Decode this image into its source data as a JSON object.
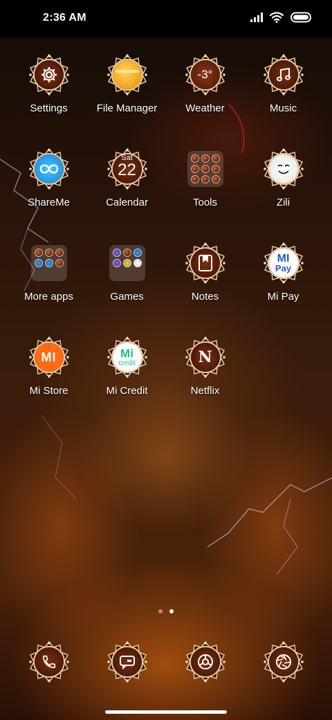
{
  "status_bar": {
    "time": "2:36 AM",
    "signal_icon": "cellular-signal-icon",
    "wifi_icon": "wifi-icon",
    "battery_icon": "battery-icon"
  },
  "home_screen": {
    "apps": [
      {
        "label": "Settings",
        "icon": "gear-icon"
      },
      {
        "label": "File Manager",
        "icon": "folder-icon"
      },
      {
        "label": "Weather",
        "icon": "weather-icon",
        "temperature": "-3°"
      },
      {
        "label": "Music",
        "icon": "music-note-icon"
      },
      {
        "label": "ShareMe",
        "icon": "shareme-icon"
      },
      {
        "label": "Calendar",
        "icon": "calendar-icon",
        "day": "Sat",
        "date": "22"
      },
      {
        "label": "Tools",
        "icon": "folder-icon"
      },
      {
        "label": "Zili",
        "icon": "zili-icon"
      },
      {
        "label": "More apps",
        "icon": "folder-icon"
      },
      {
        "label": "Games",
        "icon": "folder-icon"
      },
      {
        "label": "Notes",
        "icon": "notes-icon"
      },
      {
        "label": "Mi Pay",
        "icon": "mi-pay-icon",
        "logo_line1": "MI",
        "logo_line2": "Pay"
      },
      {
        "label": "Mi Store",
        "icon": "mi-store-icon",
        "logo_text": "MI"
      },
      {
        "label": "Mi Credit",
        "icon": "mi-credit-icon",
        "logo_line1": "Mi",
        "logo_line2": "credit"
      },
      {
        "label": "Netflix",
        "icon": "netflix-icon",
        "logo_text": "N"
      }
    ],
    "page_indicator": {
      "pages": 2,
      "active_page": 2
    }
  },
  "dock": {
    "apps": [
      {
        "name": "Phone",
        "icon": "phone-icon"
      },
      {
        "name": "Messages",
        "icon": "message-icon"
      },
      {
        "name": "Browser",
        "icon": "browser-icon"
      },
      {
        "name": "Camera",
        "icon": "camera-icon"
      }
    ]
  },
  "colors": {
    "ornament_gold": "#e8c9a0",
    "ornament_rust": "#8a3a16",
    "accent_orange": "#ff6a13",
    "shareme_blue": "#1fa4e8",
    "file_manager_yellow": "#f7b32a",
    "mi_credit_green": "#19c37d"
  }
}
